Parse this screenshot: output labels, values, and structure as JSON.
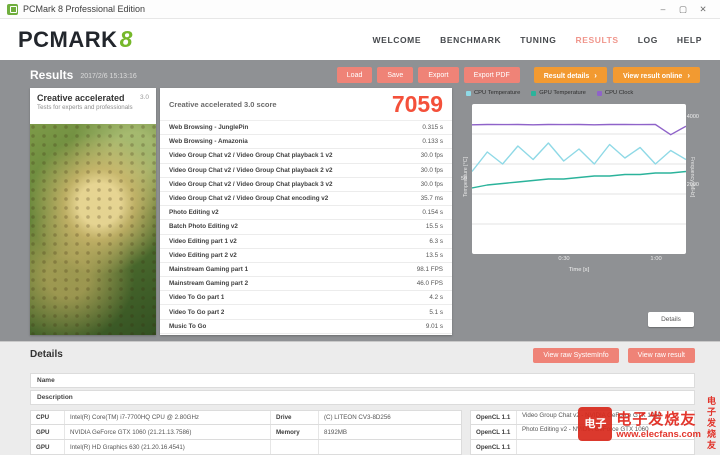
{
  "window": {
    "title": "PCMark 8 Professional Edition",
    "controls": {
      "minimize": "–",
      "maximize": "▢",
      "close": "✕"
    }
  },
  "brand": {
    "name": "PCMARK",
    "badge": "8"
  },
  "nav": {
    "items": [
      {
        "label": "WELCOME",
        "active": false
      },
      {
        "label": "BENCHMARK",
        "active": false
      },
      {
        "label": "TUNING",
        "active": false
      },
      {
        "label": "RESULTS",
        "active": true
      },
      {
        "label": "LOG",
        "active": false
      },
      {
        "label": "HELP",
        "active": false
      }
    ]
  },
  "toolbar": {
    "results_label": "Results",
    "timestamp": "2017/2/6 15:13:16",
    "buttons": [
      {
        "label": "Load"
      },
      {
        "label": "Save"
      },
      {
        "label": "Export"
      },
      {
        "label": "Export PDF"
      }
    ],
    "result_details": "Result details",
    "view_result_online": "View result online",
    "chevron": "›"
  },
  "test_panel": {
    "name": "Creative accelerated",
    "version": "3.0",
    "subtitle": "Tests for experts and professionals"
  },
  "score": {
    "title": "Creative accelerated 3.0 score",
    "value": "7059",
    "rows": [
      {
        "label": "Web Browsing - JunglePin",
        "value": "0.315 s"
      },
      {
        "label": "Web Browsing - Amazonia",
        "value": "0.133 s"
      },
      {
        "label": "Video Group Chat v2 / Video Group Chat playback 1 v2",
        "value": "30.0 fps"
      },
      {
        "label": "Video Group Chat v2 / Video Group Chat playback 2 v2",
        "value": "30.0 fps"
      },
      {
        "label": "Video Group Chat v2 / Video Group Chat playback 3 v2",
        "value": "30.0 fps"
      },
      {
        "label": "Video Group Chat v2 / Video Group Chat encoding v2",
        "value": "35.7 ms"
      },
      {
        "label": "Photo Editing v2",
        "value": "0.154 s"
      },
      {
        "label": "Batch Photo Editing v2",
        "value": "15.5 s"
      },
      {
        "label": "Video Editing part 1 v2",
        "value": "6.3 s"
      },
      {
        "label": "Video Editing part 2 v2",
        "value": "13.5 s"
      },
      {
        "label": "Mainstream Gaming part 1",
        "value": "98.1 FPS"
      },
      {
        "label": "Mainstream Gaming part 2",
        "value": "46.0 FPS"
      },
      {
        "label": "Video To Go part 1",
        "value": "4.2 s"
      },
      {
        "label": "Video To Go part 2",
        "value": "5.1 s"
      },
      {
        "label": "Music To Go",
        "value": "9.01 s"
      }
    ]
  },
  "chart_data": {
    "type": "line",
    "xlabel": "Time [s]",
    "ylabel_left": "Temperature [°C]",
    "ylabel_right": "Frequency [MHz]",
    "x_ticks": [
      "0:30",
      "1:00"
    ],
    "left_ticks": [
      "50"
    ],
    "right_ticks": [
      "4000",
      "2000"
    ],
    "left_axis_max": 100,
    "right_axis_max": 4400,
    "grid": true,
    "legend_position": "top",
    "series": [
      {
        "name": "CPU Temperature",
        "axis": "left",
        "color": "#8fd9e6",
        "values": [
          55,
          68,
          60,
          72,
          63,
          74,
          62,
          70,
          60,
          73,
          64,
          71,
          60,
          69,
          63
        ]
      },
      {
        "name": "GPU Temperature",
        "axis": "left",
        "color": "#2bb39b",
        "values": [
          44,
          46,
          47,
          48,
          49,
          50,
          50,
          51,
          52,
          52,
          53,
          53,
          54,
          54,
          55
        ]
      },
      {
        "name": "CPU Clock",
        "axis": "right",
        "color": "#8f63c9",
        "values": [
          3790,
          3800,
          3795,
          3800,
          3790,
          3800,
          3795,
          3800,
          3790,
          3800,
          3800,
          3795,
          3800,
          3500,
          3750
        ]
      }
    ]
  },
  "chart": {
    "details_button": "Details"
  },
  "details": {
    "heading": "Details",
    "view_raw_systeminfo": "View raw SystemInfo",
    "view_raw_result": "View raw result",
    "fields": [
      {
        "label": "Name",
        "value": ""
      },
      {
        "label": "Description",
        "value": ""
      }
    ],
    "system_rows": [
      {
        "c1": "CPU",
        "c2": "Intel(R) Core(TM) i7-7700HQ CPU @ 2.80GHz",
        "c3": "Drive",
        "c4": "(C) LITEON CV3-8D256"
      },
      {
        "c1": "GPU",
        "c2": "NVIDIA GeForce GTX 1060 (21.21.13.7586)",
        "c3": "Memory",
        "c4": "8192MB"
      },
      {
        "c1": "GPU",
        "c2": "Intel(R) HD Graphics 630 (21.20.16.4541)",
        "c3": "",
        "c4": ""
      }
    ],
    "opencl_rows": [
      {
        "label": "OpenCL 1.1",
        "value": "Video Group Chat v2 - NVIDIA GeForce GTX 1060"
      },
      {
        "label": "OpenCL 1.1",
        "value": "Photo Editing v2 - NVIDIA GeForce GTX 1060"
      },
      {
        "label": "OpenCL 1.1",
        "value": ""
      }
    ]
  },
  "watermark": {
    "icon": "电子",
    "title": "电子发烧友",
    "url": "www.elecfans.com",
    "vertical": "电子发烧友"
  }
}
